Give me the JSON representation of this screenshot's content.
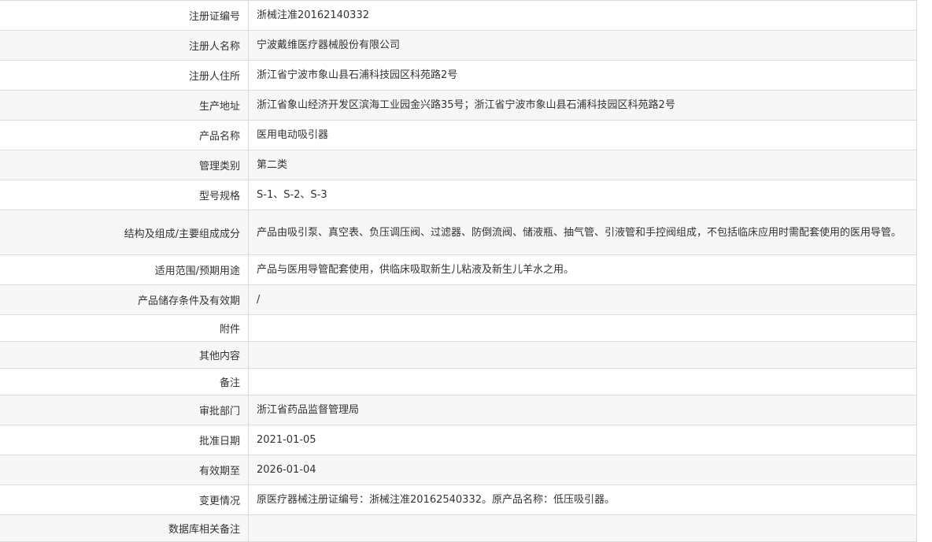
{
  "rows": [
    {
      "label": "注册证编号",
      "value": "浙械注准20162140332"
    },
    {
      "label": "注册人名称",
      "value": "宁波戴维医疗器械股份有限公司"
    },
    {
      "label": "注册人住所",
      "value": "浙江省宁波市象山县石浦科技园区科苑路2号"
    },
    {
      "label": "生产地址",
      "value": "浙江省象山经济开发区滨海工业园金兴路35号；浙江省宁波市象山县石浦科技园区科苑路2号"
    },
    {
      "label": "产品名称",
      "value": "医用电动吸引器"
    },
    {
      "label": "管理类别",
      "value": "第二类"
    },
    {
      "label": "型号规格",
      "value": "S-1、S-2、S-3"
    },
    {
      "label": "结构及组成/主要组成成分",
      "value": "产品由吸引泵、真空表、负压调压阀、过滤器、防倒流阀、储液瓶、抽气管、引液管和手控阀组成，不包括临床应用时需配套使用的医用导管。"
    },
    {
      "label": "适用范围/预期用途",
      "value": "产品与医用导管配套使用，供临床吸取新生儿粘液及新生儿羊水之用。"
    },
    {
      "label": "产品储存条件及有效期",
      "value": "/"
    },
    {
      "label": "附件",
      "value": ""
    },
    {
      "label": "其他内容",
      "value": ""
    },
    {
      "label": "备注",
      "value": ""
    },
    {
      "label": "审批部门",
      "value": "浙江省药品监督管理局"
    },
    {
      "label": "批准日期",
      "value": "2021-01-05"
    },
    {
      "label": "有效期至",
      "value": "2026-01-04"
    },
    {
      "label": "变更情况",
      "value": "原医疗器械注册证编号：浙械注准20162540332。原产品名称：低压吸引器。"
    },
    {
      "label": "数据库相关备注",
      "value": ""
    }
  ]
}
